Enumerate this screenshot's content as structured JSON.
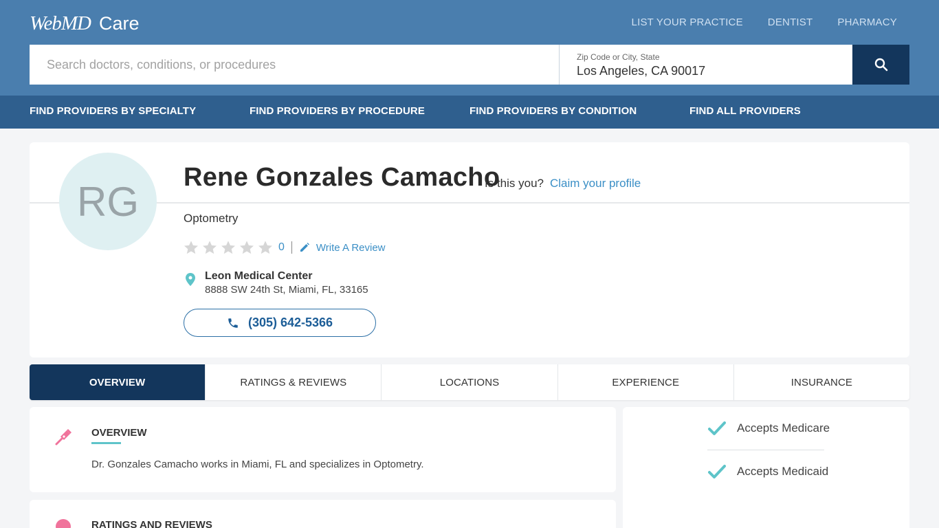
{
  "brand": {
    "logo_main": "WebMD",
    "logo_sub": "Care"
  },
  "top_links": [
    "LIST YOUR PRACTICE",
    "DENTIST",
    "PHARMACY"
  ],
  "search": {
    "placeholder": "Search doctors, conditions, or procedures",
    "location_label": "Zip Code or City, State",
    "location_value": "Los Angeles, CA 90017",
    "button_icon": "search-icon"
  },
  "nav": {
    "specialty": "FIND PROVIDERS BY SPECIALTY",
    "procedure": "FIND PROVIDERS BY PROCEDURE",
    "condition": "FIND PROVIDERS BY CONDITION",
    "all": "FIND ALL PROVIDERS"
  },
  "profile": {
    "initials": "RG",
    "name": "Rene Gonzales Camacho",
    "is_this_you": "Is this you?",
    "claim_link": "Claim your profile",
    "specialty": "Optometry",
    "rating": {
      "stars": 0,
      "max": 5,
      "count": "0"
    },
    "write_review": "Write A Review",
    "location_name": "Leon Medical Center",
    "location_address": "8888 SW 24th St, Miami, FL, 33165",
    "phone": "(305) 642-5366"
  },
  "tabs": [
    "OVERVIEW",
    "RATINGS & REVIEWS",
    "LOCATIONS",
    "EXPERIENCE",
    "INSURANCE"
  ],
  "overview": {
    "title": "OVERVIEW",
    "text": "Dr. Gonzales Camacho works in Miami, FL and specializes in Optometry."
  },
  "reviews_section": {
    "title": "RATINGS AND REVIEWS"
  },
  "insurance": {
    "medicare": "Accepts Medicare",
    "medicaid": "Accepts Medicaid"
  },
  "colors": {
    "header": "#4a7eae",
    "nav": "#2f5f8e",
    "dark_navy": "#13365c",
    "link": "#3b8fc6",
    "teal": "#5ec4c9",
    "pink": "#f0739b"
  }
}
